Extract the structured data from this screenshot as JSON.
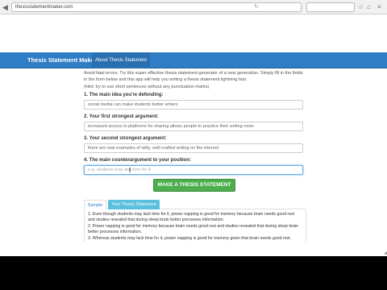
{
  "browser": {
    "url": "thesisstatementmaker.com",
    "back_icon": "back-arrow-icon",
    "forward_icon": "forward-arrow-icon"
  },
  "navbar": {
    "brand": "Thesis Statement Maker",
    "link": "About Thesis Statement",
    "color": "#2f7dc4"
  },
  "intro": {
    "text": "Avoid fatal errors. Try this super effective thesis statement generator of a new generation. Simply fill in the fields in the form below and this app will help you writing a thesis statement lightning fast.",
    "hint": "(Hint: try to use short sentences without any punctuation marks)"
  },
  "fields": [
    {
      "label": "1. The main idea you're defending:",
      "value": "social media can make students better writers"
    },
    {
      "label": "2. Your first strongest argument:",
      "value": "increased access to platforms for sharing allows people to practice their writing more"
    },
    {
      "label": "3. Your second strongest argument:",
      "value": "there are vast examples of witty, well-crafted writing on the internet"
    },
    {
      "label": "4. The main counterargument to your position:",
      "value": "",
      "placeholder": "e.g. students may ask time for it"
    }
  ],
  "make_button": "MAKE A THESIS STATEMENT",
  "tabs": [
    "Sample",
    "Your Thesis Statement"
  ],
  "results": [
    "1. Even though students may lack time for it, power napping is good for memory because brain needs good rest and studies revealed that during sleep brain better processes information.",
    "2. Power napping is good for memory because brain needs good rest and studies revealed that during sleep brain better processes information.",
    "3. Whereas students may lack time for it, power napping is good for memory given that brain needs good rest."
  ],
  "accent_green": "#4cae4c",
  "accent_cyan": "#5bc0de"
}
